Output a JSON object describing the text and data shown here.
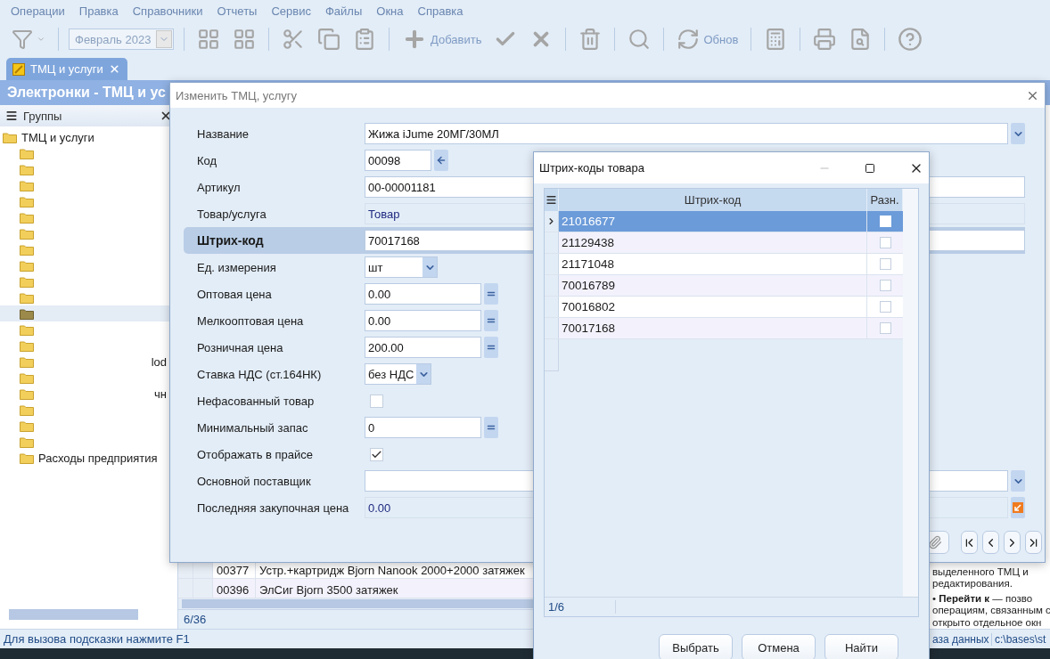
{
  "menu": [
    "Операции",
    "Правка",
    "Справочники",
    "Отчеты",
    "Сервис",
    "Файлы",
    "Окна",
    "Справка"
  ],
  "toolbar": {
    "period": "Февраль 2023",
    "add_label": "Добавить",
    "refresh_label": "Обнов"
  },
  "tabs": [
    {
      "label": "ТМЦ и услуги",
      "selected": true
    }
  ],
  "header": {
    "title": "Электронки - ТМЦ и ус"
  },
  "groups_panel": {
    "title": "Группы",
    "tree": {
      "label": "ТМЦ и услуги",
      "children": [
        {
          "kind": "blank",
          "selected": false
        },
        {
          "kind": "blank",
          "selected": false
        },
        {
          "kind": "blank",
          "selected": false
        },
        {
          "kind": "blank",
          "selected": false
        },
        {
          "kind": "blank",
          "selected": false
        },
        {
          "kind": "blank",
          "selected": false
        },
        {
          "kind": "blank",
          "selected": false
        },
        {
          "kind": "blank",
          "selected": false
        },
        {
          "kind": "blank",
          "selected": false
        },
        {
          "kind": "blank",
          "selected": false
        },
        {
          "kind": "blank",
          "selected": true
        },
        {
          "kind": "blank",
          "selected": false
        },
        {
          "kind": "blank",
          "selected": false
        },
        {
          "kind": "fragment",
          "label": "lod",
          "selected": false
        },
        {
          "kind": "blank",
          "selected": false
        },
        {
          "kind": "fragment",
          "label": "чн",
          "selected": false
        },
        {
          "kind": "blank",
          "selected": false
        },
        {
          "kind": "blank",
          "selected": false
        },
        {
          "kind": "blank",
          "selected": false
        },
        {
          "kind": "named",
          "label": "Расходы предприятия",
          "selected": false
        }
      ]
    }
  },
  "goods_grid": {
    "rows": [
      {
        "code": "00377",
        "name": "Устр.+картридж Bjorn Nanook 2000+2000 затяжек"
      },
      {
        "code": "00396",
        "name": "ЭлСиг Bjorn 3500 затяжек"
      }
    ],
    "counter": "6/36"
  },
  "help_text": [
    "выделенного ТМЦ и",
    "редактирования.",
    "• **Перейти к** — позво",
    "операциям, связанным с",
    "открыто отдельное окн"
  ],
  "status_bar": {
    "hint": "Для вызова подсказки нажмите F1",
    "items": [
      "аза данных",
      "c:\\bases\\st"
    ]
  },
  "edit_dialog": {
    "title": "Изменить ТМЦ, услугу",
    "fields": [
      {
        "label": "Название",
        "kind": "combo",
        "value": "Жижа iJume 20МГ/30МЛ",
        "highlighted": false
      },
      {
        "label": "Код",
        "kind": "code",
        "value": "00098",
        "highlighted": false
      },
      {
        "label": "Артикул",
        "kind": "text",
        "value": "00-00001181",
        "highlighted": false
      },
      {
        "label": "Товар/услуга",
        "kind": "readonly",
        "value": "Товар",
        "highlighted": false
      },
      {
        "label": "Штрих-код",
        "kind": "text",
        "value": "70017168",
        "highlighted": true
      },
      {
        "label": "Ед. измерения",
        "kind": "select",
        "value": "шт",
        "highlighted": false
      },
      {
        "label": "Оптовая цена",
        "kind": "number",
        "value": "0.00",
        "highlighted": false
      },
      {
        "label": "Мелкооптовая цена",
        "kind": "number",
        "value": "0.00",
        "highlighted": false
      },
      {
        "label": "Розничная цена",
        "kind": "number",
        "value": "200.00",
        "highlighted": false
      },
      {
        "label": "Ставка НДС (ст.164НК)",
        "kind": "select",
        "value": "без НДС",
        "highlighted": false
      },
      {
        "label": "Нефасованный товар",
        "kind": "checkbox",
        "checked": false,
        "highlighted": false
      },
      {
        "label": "Минимальный запас",
        "kind": "number",
        "value": "0",
        "highlighted": false
      },
      {
        "label": "Отображать в прайсе",
        "kind": "checkbox",
        "checked": true,
        "highlighted": false
      },
      {
        "label": "Основной поставщик",
        "kind": "combo",
        "highlighted": false
      },
      {
        "label": "Последняя закупочная цена",
        "kind": "readonly_pick",
        "value": "0.00",
        "highlighted": false
      }
    ]
  },
  "barcode_dialog": {
    "title": "Штрих-коды товара",
    "columns": [
      "Штрих-код",
      "Разн."
    ],
    "rows": [
      {
        "code": "21016677",
        "diff": false,
        "selected": true
      },
      {
        "code": "21129438",
        "diff": false,
        "selected": false
      },
      {
        "code": "21171048",
        "diff": false,
        "selected": false
      },
      {
        "code": "70016789",
        "diff": false,
        "selected": false
      },
      {
        "code": "70016802",
        "diff": false,
        "selected": false
      },
      {
        "code": "70017168",
        "diff": false,
        "selected": false
      }
    ],
    "counter": "1/6",
    "buttons": [
      "Выбрать",
      "Отмена",
      "Найти"
    ]
  }
}
